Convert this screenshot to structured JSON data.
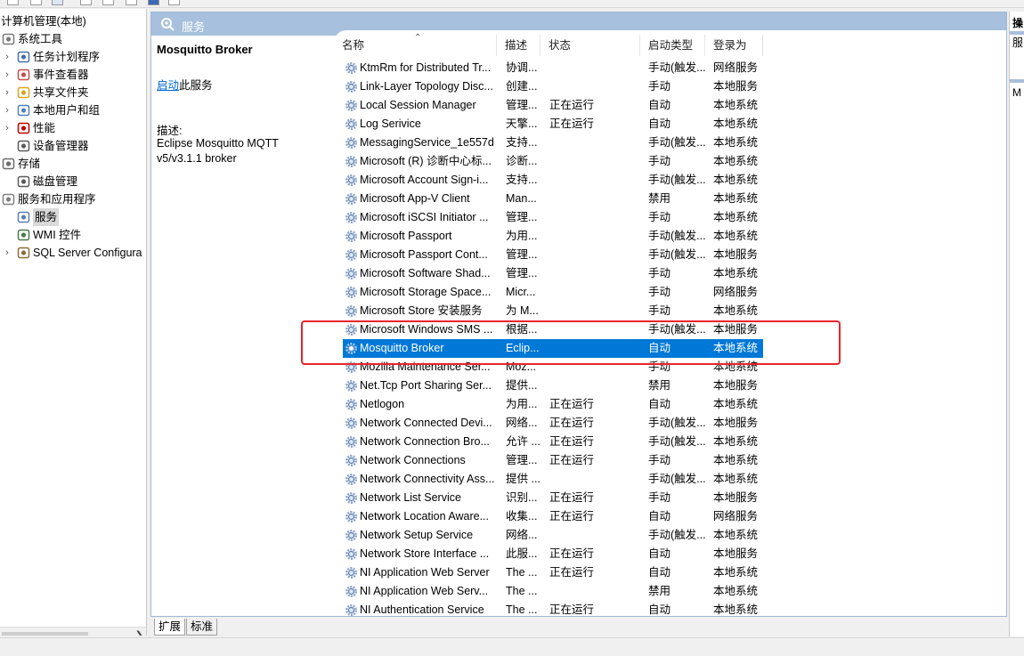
{
  "tree": {
    "root": "计算机管理(本地)",
    "items": [
      {
        "label": "系统工具",
        "icon": "tools-icon",
        "level": 0,
        "arrow": "chevron-down-icon"
      },
      {
        "label": "任务计划程序",
        "icon": "clock-icon",
        "level": 1,
        "arrow": "chevron-right-icon"
      },
      {
        "label": "事件查看器",
        "icon": "event-viewer-icon",
        "level": 1,
        "arrow": "chevron-right-icon"
      },
      {
        "label": "共享文件夹",
        "icon": "shared-folder-icon",
        "level": 1,
        "arrow": "chevron-right-icon"
      },
      {
        "label": "本地用户和组",
        "icon": "users-icon",
        "level": 1,
        "arrow": "chevron-right-icon"
      },
      {
        "label": "性能",
        "icon": "performance-icon",
        "level": 1,
        "arrow": "chevron-right-icon"
      },
      {
        "label": "设备管理器",
        "icon": "device-manager-icon",
        "level": 1,
        "arrow": ""
      },
      {
        "label": "存储",
        "icon": "storage-icon",
        "level": 0,
        "arrow": "chevron-down-icon"
      },
      {
        "label": "磁盘管理",
        "icon": "disk-icon",
        "level": 1,
        "arrow": ""
      },
      {
        "label": "服务和应用程序",
        "icon": "services-apps-icon",
        "level": 0,
        "arrow": "chevron-down-icon"
      },
      {
        "label": "服务",
        "icon": "services-icon",
        "level": 1,
        "arrow": "",
        "selected": true
      },
      {
        "label": "WMI 控件",
        "icon": "wmi-icon",
        "level": 1,
        "arrow": ""
      },
      {
        "label": "SQL Server Configura",
        "icon": "sql-server-icon",
        "level": 1,
        "arrow": "chevron-right-icon"
      }
    ]
  },
  "header": {
    "title": "服务",
    "icon": "services-icon"
  },
  "detail": {
    "service_name": "Mosquitto Broker",
    "start_link": "启动",
    "start_suffix": "此服务",
    "desc_label": "描述:",
    "description": "Eclipse Mosquitto MQTT v5/v3.1.1 broker"
  },
  "columns": {
    "name": "名称",
    "desc": "描述",
    "status": "状态",
    "startup": "启动类型",
    "logon": "登录为"
  },
  "services": [
    {
      "name": "KtmRm for Distributed Tr...",
      "desc": "协调...",
      "status": "",
      "startup": "手动(触发...",
      "logon": "网络服务"
    },
    {
      "name": "Link-Layer Topology Disc...",
      "desc": "创建...",
      "status": "",
      "startup": "手动",
      "logon": "本地服务"
    },
    {
      "name": "Local Session Manager",
      "desc": "管理...",
      "status": "正在运行",
      "startup": "自动",
      "logon": "本地系统"
    },
    {
      "name": "Log Serivice",
      "desc": "天擎...",
      "status": "正在运行",
      "startup": "自动",
      "logon": "本地系统"
    },
    {
      "name": "MessagingService_1e557d",
      "desc": "支持...",
      "status": "",
      "startup": "手动(触发...",
      "logon": "本地系统"
    },
    {
      "name": "Microsoft (R) 诊断中心标...",
      "desc": "诊断...",
      "status": "",
      "startup": "手动",
      "logon": "本地系统"
    },
    {
      "name": "Microsoft Account Sign-i...",
      "desc": "支持...",
      "status": "",
      "startup": "手动(触发...",
      "logon": "本地系统"
    },
    {
      "name": "Microsoft App-V Client",
      "desc": "Man...",
      "status": "",
      "startup": "禁用",
      "logon": "本地系统"
    },
    {
      "name": "Microsoft iSCSI Initiator ...",
      "desc": "管理...",
      "status": "",
      "startup": "手动",
      "logon": "本地系统"
    },
    {
      "name": "Microsoft Passport",
      "desc": "为用...",
      "status": "",
      "startup": "手动(触发...",
      "logon": "本地系统"
    },
    {
      "name": "Microsoft Passport Cont...",
      "desc": "管理...",
      "status": "",
      "startup": "手动(触发...",
      "logon": "本地服务"
    },
    {
      "name": "Microsoft Software Shad...",
      "desc": "管理...",
      "status": "",
      "startup": "手动",
      "logon": "本地系统"
    },
    {
      "name": "Microsoft Storage Space...",
      "desc": "Micr...",
      "status": "",
      "startup": "手动",
      "logon": "网络服务"
    },
    {
      "name": "Microsoft Store 安装服务",
      "desc": "为 M...",
      "status": "",
      "startup": "手动",
      "logon": "本地系统"
    },
    {
      "name": "Microsoft Windows SMS ...",
      "desc": "根据...",
      "status": "",
      "startup": "手动(触发...",
      "logon": "本地服务"
    },
    {
      "name": "Mosquitto Broker",
      "desc": "Eclip...",
      "status": "",
      "startup": "自动",
      "logon": "本地系统",
      "selected": true
    },
    {
      "name": "Mozilla Maintenance Ser...",
      "desc": "Moz...",
      "status": "",
      "startup": "手动",
      "logon": "本地系统"
    },
    {
      "name": "Net.Tcp Port Sharing Ser...",
      "desc": "提供...",
      "status": "",
      "startup": "禁用",
      "logon": "本地服务"
    },
    {
      "name": "Netlogon",
      "desc": "为用...",
      "status": "正在运行",
      "startup": "自动",
      "logon": "本地系统"
    },
    {
      "name": "Network Connected Devi...",
      "desc": "网络...",
      "status": "正在运行",
      "startup": "手动(触发...",
      "logon": "本地服务"
    },
    {
      "name": "Network Connection Bro...",
      "desc": "允许 ...",
      "status": "正在运行",
      "startup": "手动(触发...",
      "logon": "本地系统"
    },
    {
      "name": "Network Connections",
      "desc": "管理...",
      "status": "正在运行",
      "startup": "手动",
      "logon": "本地系统"
    },
    {
      "name": "Network Connectivity Ass...",
      "desc": "提供 ...",
      "status": "",
      "startup": "手动(触发...",
      "logon": "本地系统"
    },
    {
      "name": "Network List Service",
      "desc": "识别...",
      "status": "正在运行",
      "startup": "手动",
      "logon": "本地服务"
    },
    {
      "name": "Network Location Aware...",
      "desc": "收集...",
      "status": "正在运行",
      "startup": "自动",
      "logon": "网络服务"
    },
    {
      "name": "Network Setup Service",
      "desc": "网络...",
      "status": "",
      "startup": "手动(触发...",
      "logon": "本地系统"
    },
    {
      "name": "Network Store Interface ...",
      "desc": "此服...",
      "status": "正在运行",
      "startup": "自动",
      "logon": "本地服务"
    },
    {
      "name": "NI Application Web Server",
      "desc": "The ...",
      "status": "正在运行",
      "startup": "自动",
      "logon": "本地系统"
    },
    {
      "name": "NI Application Web Serv...",
      "desc": "The ...",
      "status": "",
      "startup": "禁用",
      "logon": "本地系统"
    },
    {
      "name": "NI Authentication Service",
      "desc": "The ...",
      "status": "正在运行",
      "startup": "自动",
      "logon": "本地系统"
    }
  ],
  "tabs": [
    "扩展",
    "标准"
  ],
  "right_pane": {
    "items": [
      "操",
      "服",
      "M"
    ]
  },
  "colors": {
    "header_bar": "#a7c0dd",
    "selection": "#0078d7",
    "highlight_box": "#e8252a",
    "link": "#0066cc"
  }
}
